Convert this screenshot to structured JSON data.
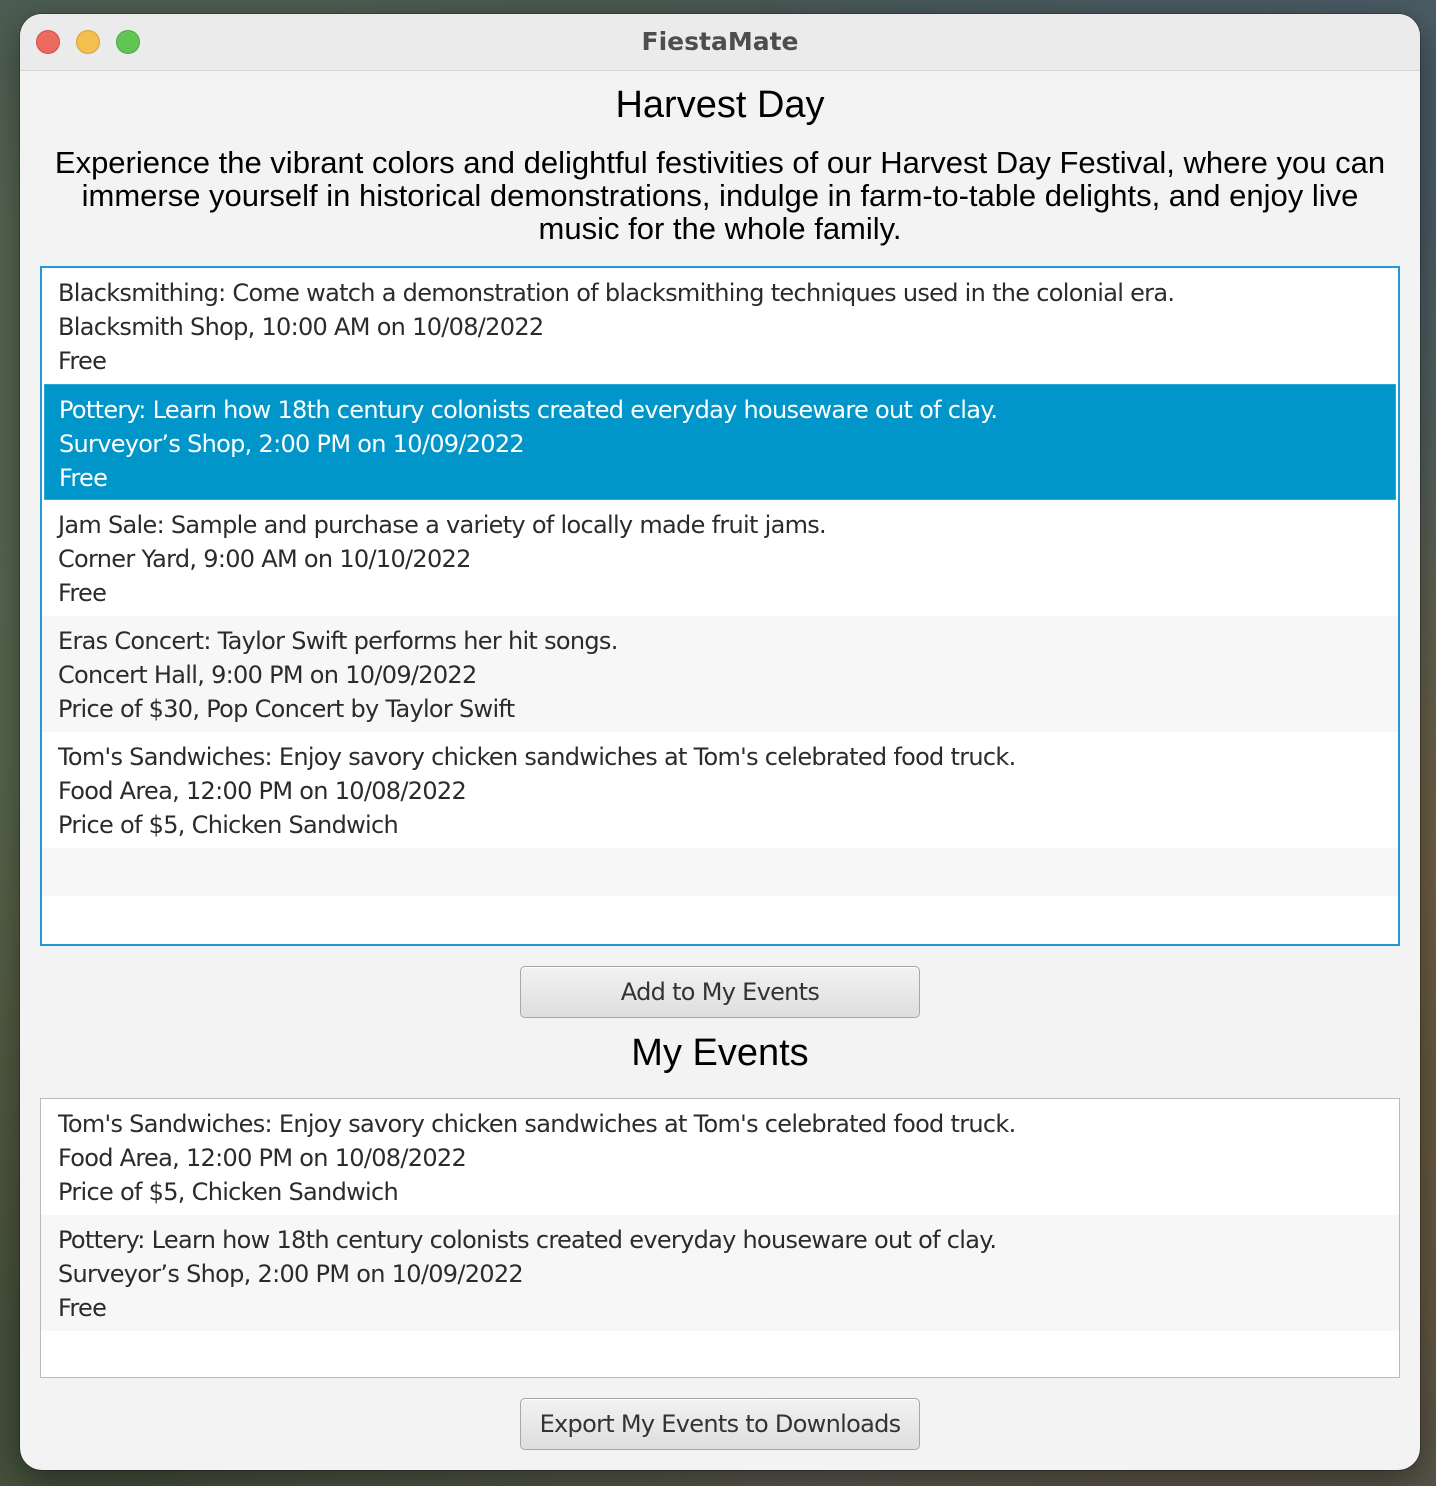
{
  "window": {
    "title": "FiestaMate"
  },
  "festival": {
    "name": "Harvest Day",
    "description": "Experience the vibrant colors and delightful festivities of our Harvest Day Festival, where you can immerse yourself in historical demonstrations, indulge in farm-to-table delights, and enjoy live music for the whole family."
  },
  "events": [
    {
      "line1": "Blacksmithing: Come watch a demonstration of blacksmithing techniques used in the colonial era.",
      "line2": "Blacksmith Shop, 10:00 AM on 10/08/2022",
      "line3": "Free",
      "selected": false
    },
    {
      "line1": "Pottery: Learn how 18th century colonists created everyday houseware out of clay.",
      "line2": "Surveyor’s Shop, 2:00 PM on 10/09/2022",
      "line3": "Free",
      "selected": true
    },
    {
      "line1": "Jam Sale: Sample and purchase a variety of locally made fruit jams.",
      "line2": "Corner Yard, 9:00 AM on 10/10/2022",
      "line3": "Free",
      "selected": false
    },
    {
      "line1": "Eras Concert: Taylor Swift performs her hit songs.",
      "line2": "Concert Hall, 9:00 PM on 10/09/2022",
      "line3": "Price of $30, Pop Concert by Taylor Swift",
      "selected": false
    },
    {
      "line1": "Tom's Sandwiches: Enjoy savory chicken sandwiches at Tom's celebrated food truck.",
      "line2": "Food Area, 12:00 PM on 10/08/2022",
      "line3": "Price of $5, Chicken Sandwich",
      "selected": false
    }
  ],
  "add_button": {
    "label": "Add to My Events"
  },
  "my_events": {
    "title": "My Events",
    "items": [
      {
        "line1": "Tom's Sandwiches: Enjoy savory chicken sandwiches at Tom's celebrated food truck.",
        "line2": "Food Area, 12:00 PM on 10/08/2022",
        "line3": "Price of $5, Chicken Sandwich"
      },
      {
        "line1": "Pottery: Learn how 18th century colonists created everyday houseware out of clay.",
        "line2": "Surveyor’s Shop, 2:00 PM on 10/09/2022",
        "line3": "Free"
      }
    ]
  },
  "export_button": {
    "label": "Export My Events to Downloads"
  },
  "colors": {
    "selection": "#0096c9",
    "focus_border": "#1f9ad2",
    "window_bg": "#f3f3f3"
  }
}
